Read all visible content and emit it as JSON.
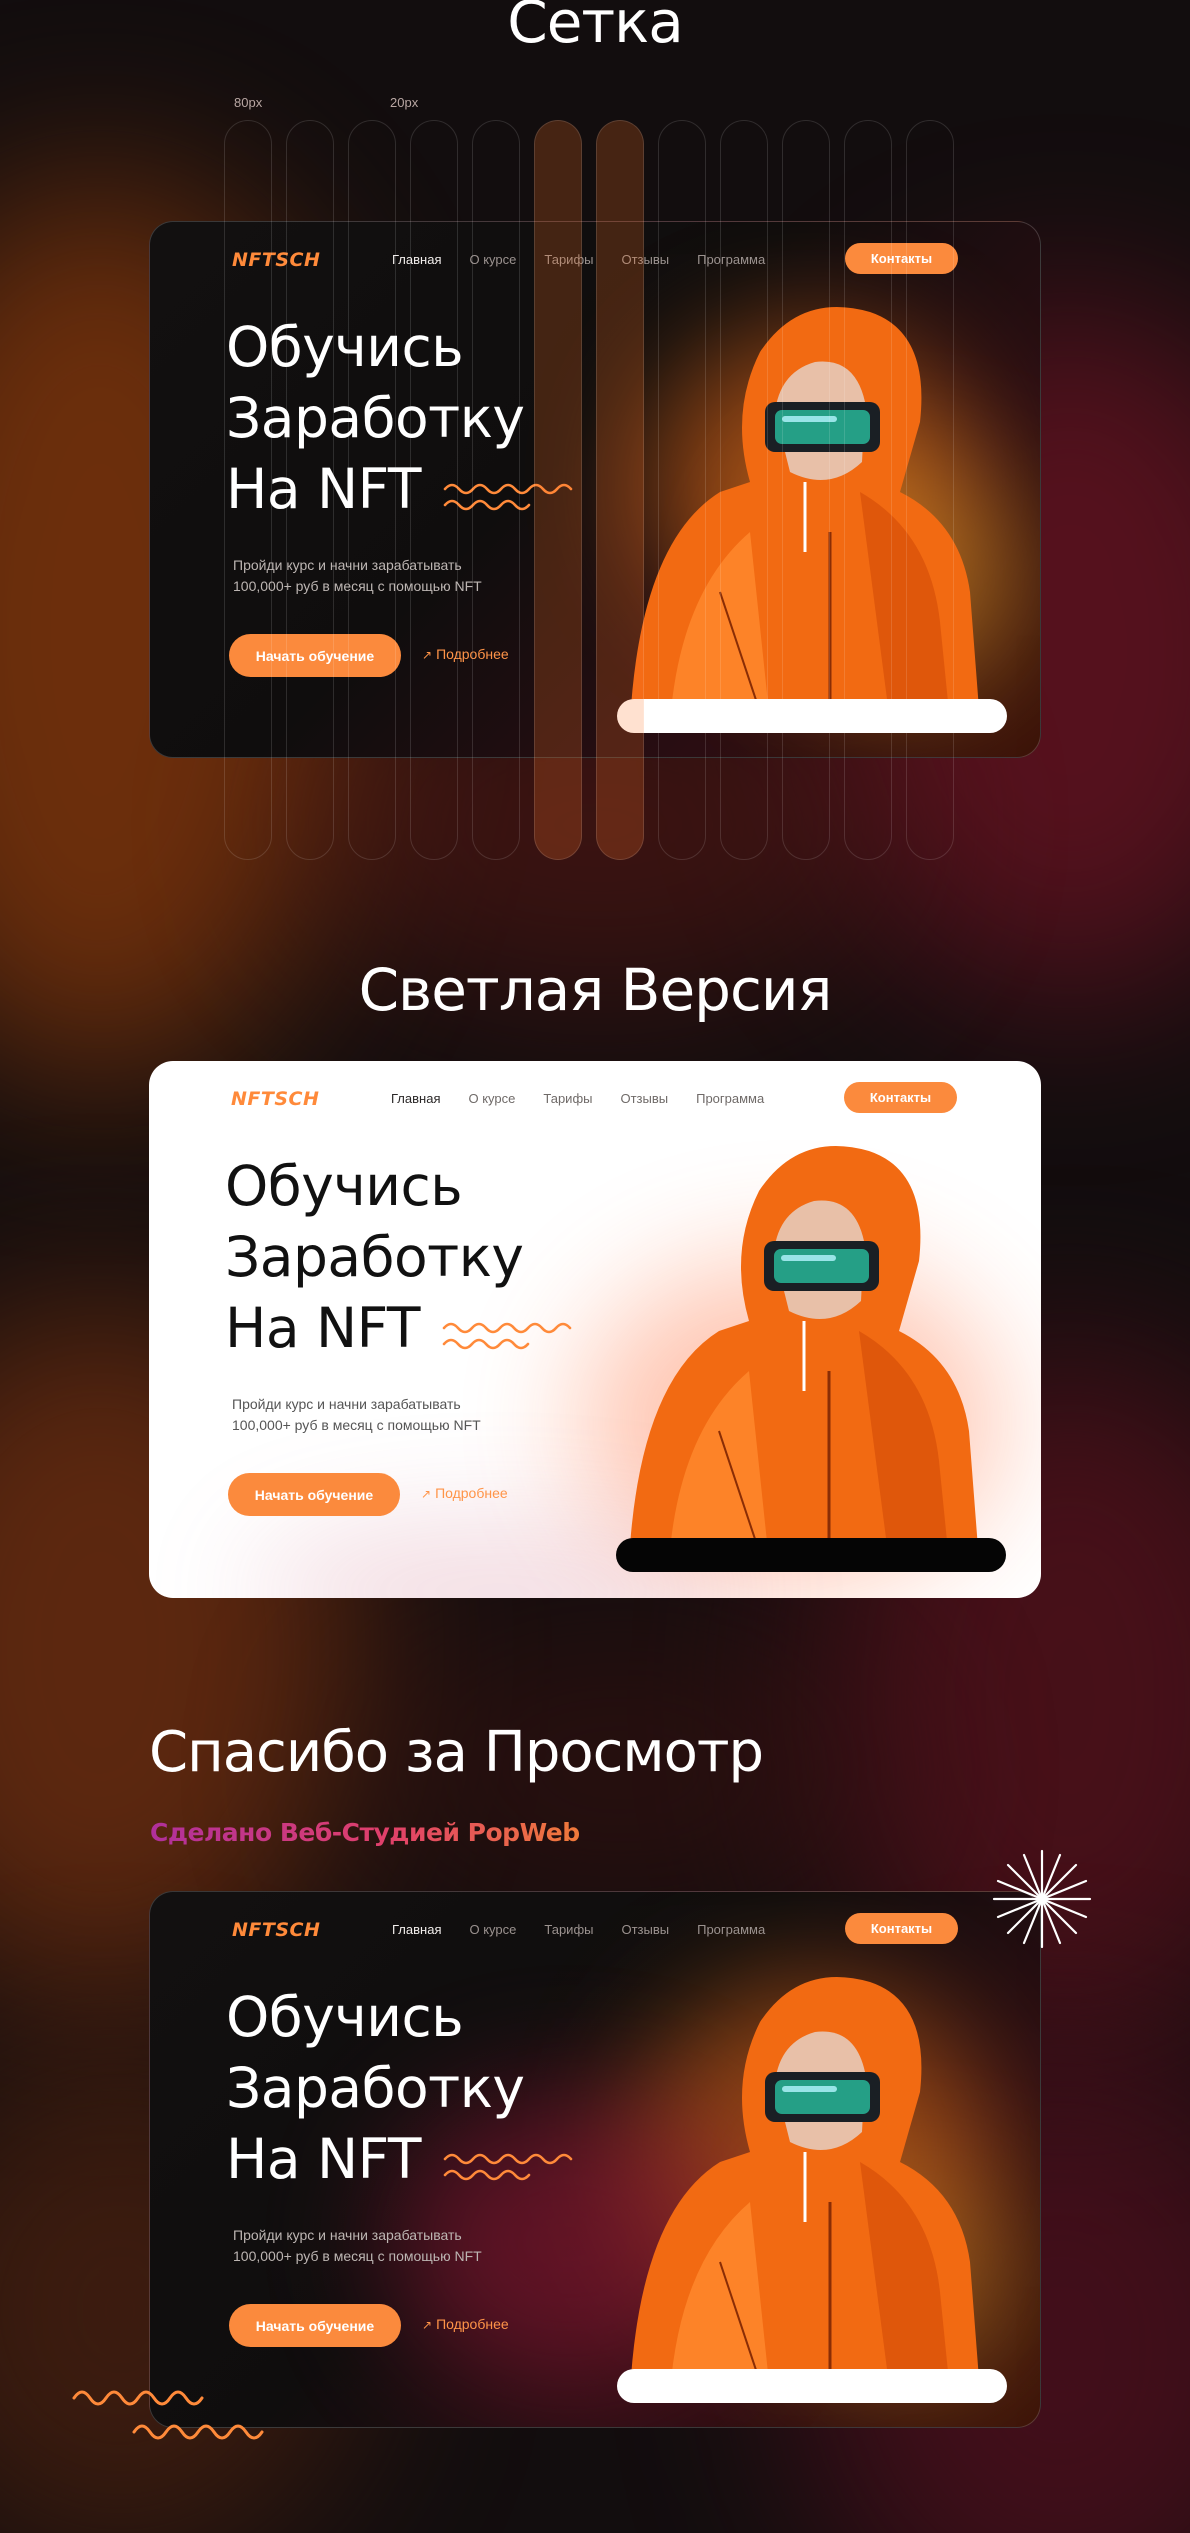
{
  "sections": {
    "grid_title": "Сетка",
    "light_title": "Светлая Версия",
    "thanks_title": "Спасибо за Просмотр",
    "made_by": "Сделано Веб-Студией PopWeb"
  },
  "grid_labels": {
    "column": "80px",
    "gutter": "20px"
  },
  "landing": {
    "logo": "NFTSCH",
    "nav": [
      "Главная",
      "О курсе",
      "Тарифы",
      "Отзывы",
      "Программа"
    ],
    "contact_button": "Контакты",
    "hero_title": [
      "Обучись",
      "Заработку",
      "На NFT"
    ],
    "hero_subtitle": [
      "Пройди курс и начни зарабатывать",
      "100,000+ руб в месяц с помощью NFT"
    ],
    "start_button": "Начать обучение",
    "more_link": "Подробнее",
    "more_link_icon": "arrow-up-right-icon"
  },
  "colors": {
    "accent": "#fb8a3d",
    "background": "#120d0e",
    "made_by_gradient": [
      "#b0309c",
      "#e0406a",
      "#f07a3a"
    ]
  }
}
